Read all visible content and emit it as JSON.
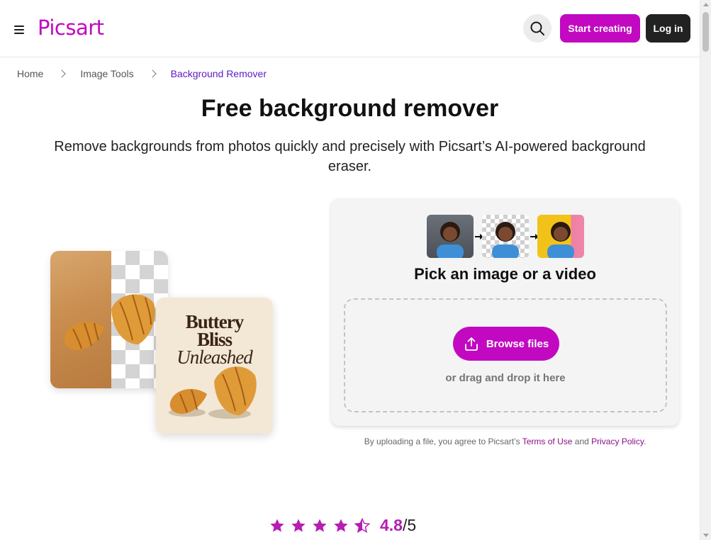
{
  "header": {
    "logo": "Picsart",
    "start_label": "Start creating",
    "login_label": "Log in"
  },
  "breadcrumb": {
    "items": [
      "Home",
      "Image Tools",
      "Background Remover"
    ]
  },
  "hero": {
    "title": "Free background remover",
    "subtitle": "Remove backgrounds from photos quickly and precisely with Picsart’s AI-powered background eraser."
  },
  "illustration": {
    "line1": "Buttery",
    "line2": "Bliss",
    "line3": "Unleashed"
  },
  "upload": {
    "title": "Pick an image or a video",
    "browse_label": "Browse files",
    "drag_text": "or drag and drop it here",
    "legal_prefix": "By uploading a file, you agree to Picsart’s ",
    "terms_label": "Terms of Use",
    "legal_and": " and ",
    "privacy_label": "Privacy Policy",
    "legal_suffix": "."
  },
  "rating": {
    "value": "4.8",
    "max": "/5",
    "stars": 4.5
  },
  "colors": {
    "brand": "#c209c1",
    "breadcrumb_active": "#5b1ac0",
    "dark_button": "#222222"
  },
  "icons": [
    "menu-icon",
    "search-icon",
    "chevron-right-icon",
    "upload-icon",
    "star-icon",
    "half-star-icon"
  ]
}
